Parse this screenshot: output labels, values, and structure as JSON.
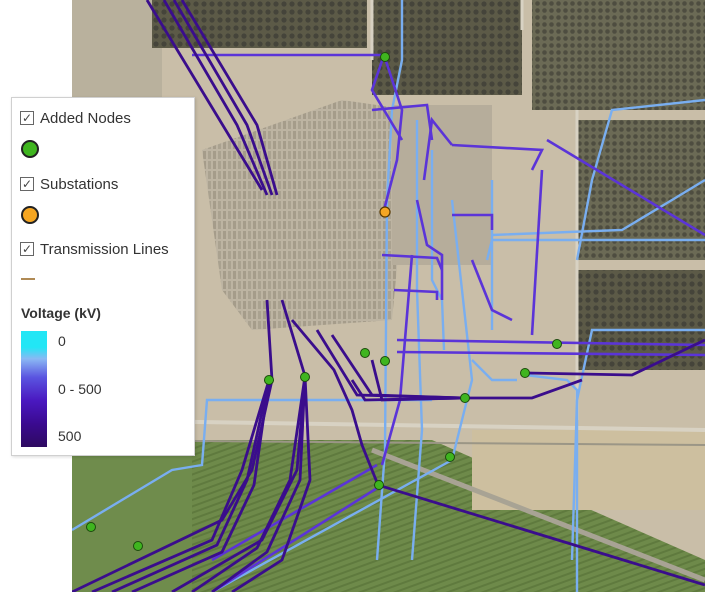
{
  "legend": {
    "layers": [
      {
        "label": "Added Nodes",
        "checked": true,
        "symbol": "green-circle"
      },
      {
        "label": "Substations",
        "checked": true,
        "symbol": "orange-circle"
      },
      {
        "label": "Transmission Lines",
        "checked": true,
        "symbol": "brown-line"
      }
    ],
    "ramp": {
      "title": "Voltage (kV)",
      "labels": [
        "0",
        "0 - 500",
        "500"
      ]
    },
    "check_glyph": "✓"
  },
  "colors": {
    "added_node": "#3fb51f",
    "substation": "#f5a622",
    "line_low": "#79aef0",
    "line_mid": "#5b34d8",
    "line_high": "#3a0d8c"
  }
}
